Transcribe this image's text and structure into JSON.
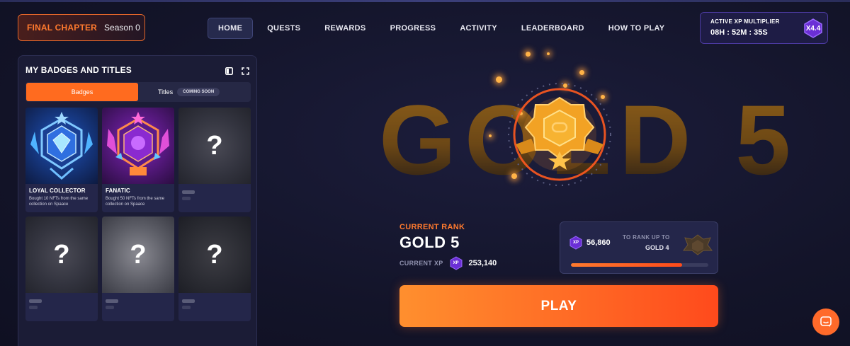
{
  "brand": {
    "title": "FINAL CHAPTER",
    "season": "Season 0"
  },
  "nav": [
    "HOME",
    "QUESTS",
    "REWARDS",
    "PROGRESS",
    "ACTIVITY",
    "LEADERBOARD",
    "HOW TO PLAY"
  ],
  "nav_active": "HOME",
  "multiplier": {
    "label": "ACTIVE XP MULTIPLIER",
    "timer": "08H : 52M : 35S",
    "value": "X4.4"
  },
  "badges_panel": {
    "title": "MY BADGES AND TITLES",
    "tabs": {
      "badges": "Badges",
      "titles": "Titles",
      "coming_soon": "COMING SOON"
    },
    "cards": [
      {
        "name": "LOYAL COLLECTOR",
        "desc": "Bought 10 NFTs from the same collection on Spaace",
        "locked": false
      },
      {
        "name": "FANATIC",
        "desc": "Bought 50 NFTs from the same collection on Spaace",
        "locked": false
      },
      {
        "name": "",
        "desc": "",
        "locked": true,
        "symbol": "?"
      },
      {
        "name": "",
        "desc": "",
        "locked": true,
        "symbol": "?"
      },
      {
        "name": "",
        "desc": "",
        "locked": true,
        "symbol": "?"
      },
      {
        "name": "",
        "desc": "",
        "locked": true,
        "symbol": "?"
      }
    ]
  },
  "hero": {
    "background_text": "GOLD 5",
    "medal_icon": "gold-medal-icon"
  },
  "rank": {
    "current_label": "CURRENT RANK",
    "name": "GOLD 5",
    "current_xp_label": "CURRENT XP",
    "current_xp": "253,140",
    "xp_badge": "XP"
  },
  "next_rank": {
    "xp_needed": "56,860",
    "label": "TO RANK UP TO",
    "name": "GOLD 4",
    "progress": 0.81
  },
  "play_label": "PLAY",
  "colors": {
    "accent": "#ff6b1f",
    "background": "#15162e",
    "xp_purple": "#6b2fd6"
  }
}
